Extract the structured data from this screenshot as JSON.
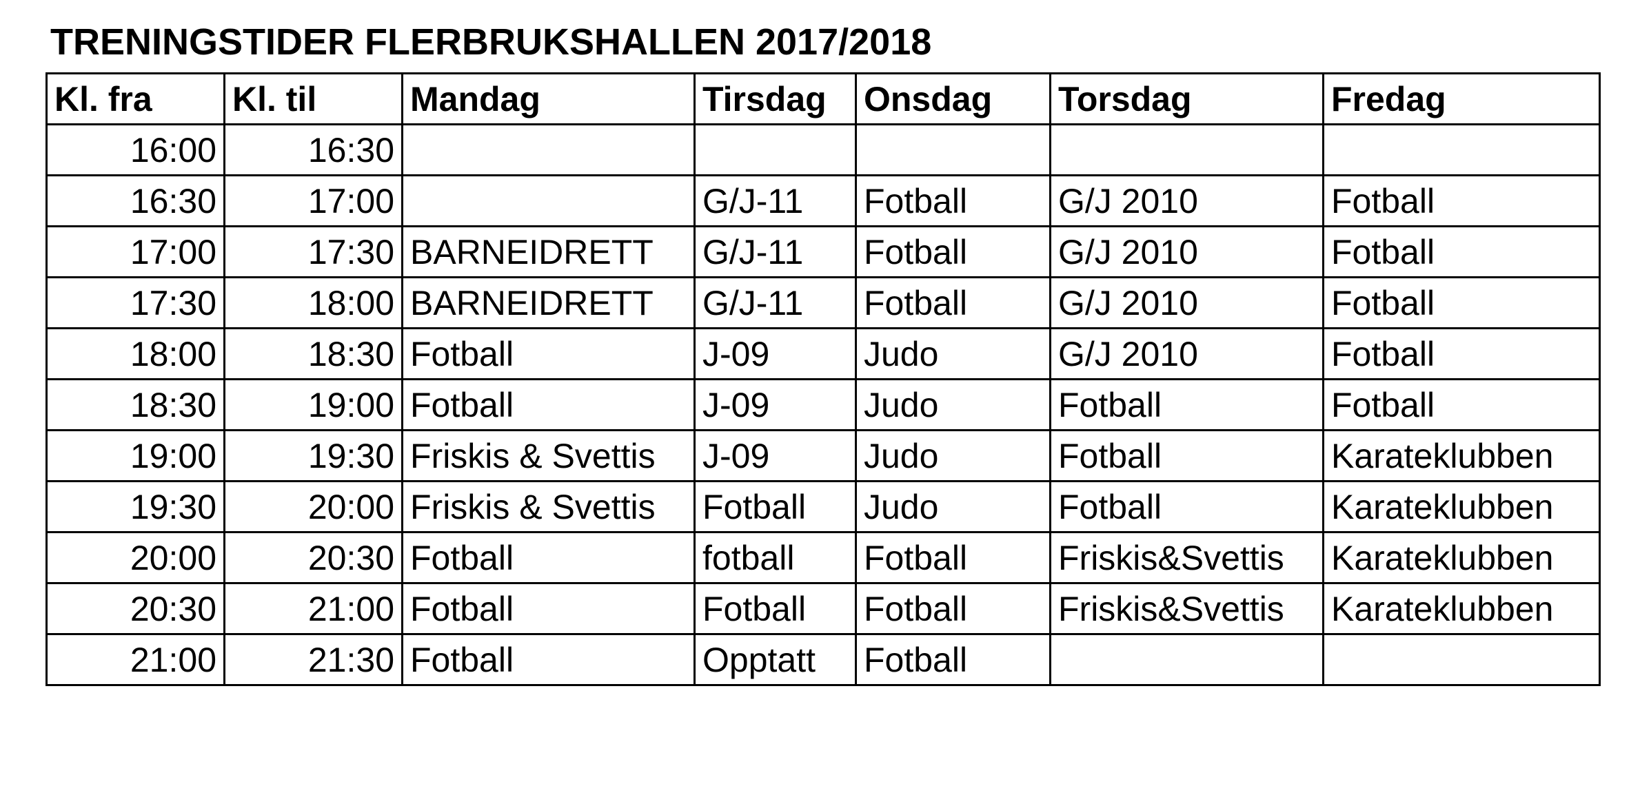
{
  "document": {
    "title": "TRENINGSTIDER FLERBRUKSHALLEN 2017/2018"
  },
  "table": {
    "headers": [
      "Kl. fra",
      "Kl. til",
      "Mandag",
      "Tirsdag",
      "Onsdag",
      "Torsdag",
      "Fredag"
    ],
    "rows": [
      [
        "16:00",
        "16:30",
        "",
        "",
        "",
        "",
        ""
      ],
      [
        "16:30",
        "17:00",
        "",
        "G/J-11",
        "Fotball",
        "G/J 2010",
        "Fotball"
      ],
      [
        "17:00",
        "17:30",
        "BARNEIDRETT",
        "G/J-11",
        "Fotball",
        "G/J 2010",
        "Fotball"
      ],
      [
        "17:30",
        "18:00",
        "BARNEIDRETT",
        "G/J-11",
        "Fotball",
        "G/J 2010",
        "Fotball"
      ],
      [
        "18:00",
        "18:30",
        "Fotball",
        "J-09",
        "Judo",
        "G/J 2010",
        "Fotball"
      ],
      [
        "18:30",
        "19:00",
        "Fotball",
        "J-09",
        "Judo",
        "Fotball",
        "Fotball"
      ],
      [
        "19:00",
        "19:30",
        "Friskis & Svettis",
        "J-09",
        "Judo",
        "Fotball",
        "Karateklubben"
      ],
      [
        "19:30",
        "20:00",
        "Friskis & Svettis",
        "Fotball",
        "Judo",
        "Fotball",
        "Karateklubben"
      ],
      [
        "20:00",
        "20:30",
        "Fotball",
        "fotball",
        "Fotball",
        "Friskis&Svettis",
        "Karateklubben"
      ],
      [
        "20:30",
        "21:00",
        "Fotball",
        "Fotball",
        "Fotball",
        "Friskis&Svettis",
        "Karateklubben"
      ],
      [
        "21:00",
        "21:30",
        "Fotball",
        "Opptatt",
        "Fotball",
        "",
        ""
      ]
    ]
  }
}
